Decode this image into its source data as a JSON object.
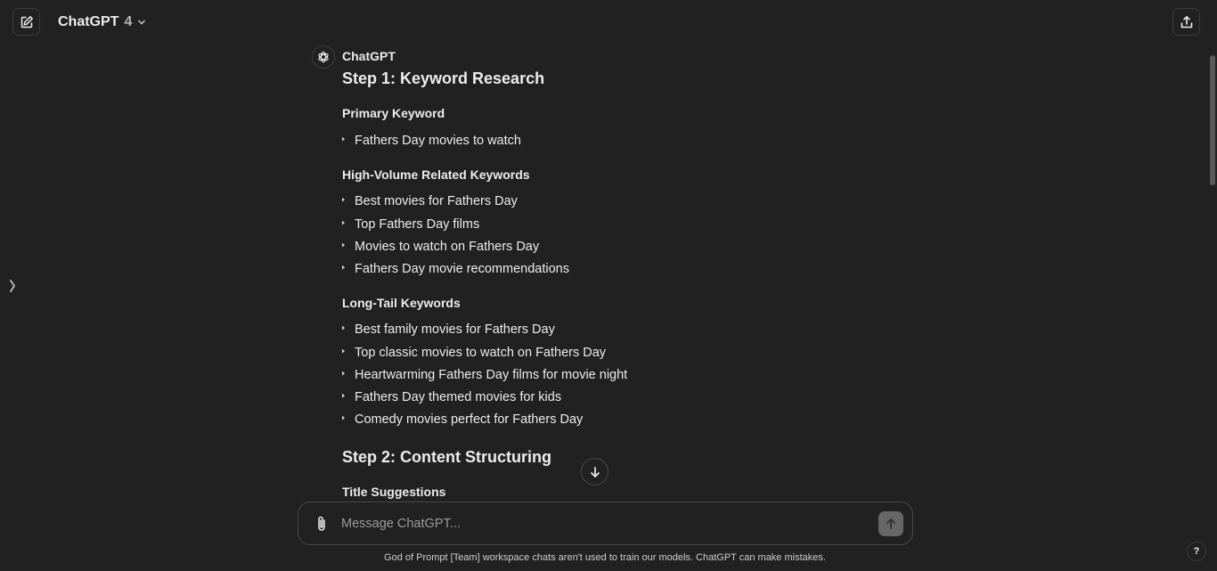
{
  "header": {
    "model_name": "ChatGPT",
    "model_version": "4"
  },
  "message": {
    "sender": "ChatGPT",
    "step1_title": "Step 1: Keyword Research",
    "primary_heading": "Primary Keyword",
    "primary_items": [
      "Fathers Day movies to watch"
    ],
    "related_heading": "High-Volume Related Keywords",
    "related_items": [
      "Best movies for Fathers Day",
      "Top Fathers Day films",
      "Movies to watch on Fathers Day",
      "Fathers Day movie recommendations"
    ],
    "longtail_heading": "Long-Tail Keywords",
    "longtail_items": [
      "Best family movies for Fathers Day",
      "Top classic movies to watch on Fathers Day",
      "Heartwarming Fathers Day films for movie night",
      "Fathers Day themed movies for kids",
      "Comedy movies perfect for Fathers Day"
    ],
    "step2_title": "Step 2: Content Structuring",
    "title_suggestions_heading": "Title Suggestions"
  },
  "composer": {
    "placeholder": "Message ChatGPT..."
  },
  "footer": {
    "disclaimer": "God of Prompt [Team] workspace chats aren't used to train our models. ChatGPT can make mistakes.",
    "help_label": "?"
  },
  "colors": {
    "background": "#212121",
    "text": "#ececec",
    "border": "#4a4a4a",
    "send_button": "#676767"
  },
  "icons": {
    "new_chat": "edit-square-icon",
    "share": "upload-share-icon",
    "dropdown": "chevron-down-icon",
    "sidebar": "chevron-right-icon",
    "avatar": "openai-logo-icon",
    "scroll_down": "arrow-down-icon",
    "attach": "paperclip-icon",
    "send": "arrow-up-icon"
  }
}
